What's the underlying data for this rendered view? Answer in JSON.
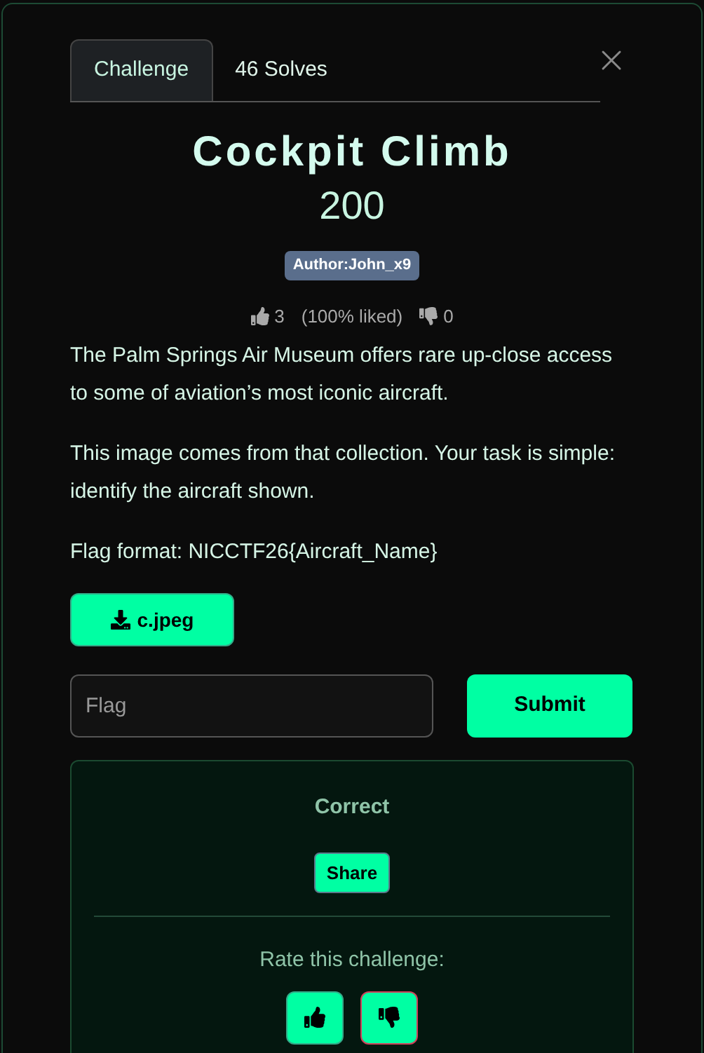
{
  "tabs": [
    {
      "label": "Challenge",
      "selected": true
    },
    {
      "label": "46 Solves",
      "selected": false
    }
  ],
  "title": "Cockpit Climb",
  "points": "200",
  "author": "Author:John_x9",
  "likes": {
    "up": "3",
    "percent": "(100% liked)",
    "down": "0"
  },
  "description": [
    "The Palm Springs Air Museum offers rare up-close access to some of aviation’s most iconic aircraft.",
    "This image comes from that collection. Your task is simple: identify the aircraft shown.",
    "Flag format: NICCTF26{Aircraft_Name}"
  ],
  "file": "c.jpeg",
  "flag_input": {
    "placeholder": "Flag"
  },
  "submit": "Submit",
  "result": {
    "status": "Correct",
    "share": "Share",
    "rate_prompt": "Rate this challenge:"
  }
}
